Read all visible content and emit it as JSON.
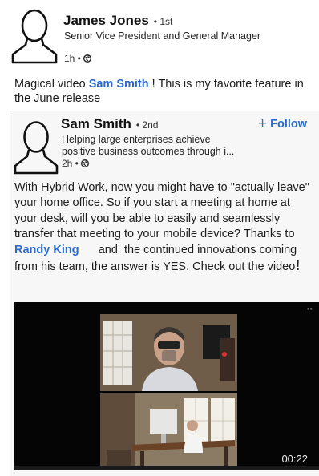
{
  "outer_post": {
    "author_name": "James Jones",
    "degree": "• 1st",
    "headline": "Senior Vice President and General Manager",
    "time": "1h •",
    "text_before": "Magical video ",
    "mention": "Sam Smith",
    "text_after": " ! This is my favorite feature in the June release"
  },
  "shared_post": {
    "author_name": "Sam Smith",
    "degree": "• 2nd",
    "headline_line1": "Helping large enterprises achieve",
    "headline_line2": "positive business outcomes through i...",
    "time": "2h •",
    "follow_label": "Follow",
    "text_part1": "With Hybrid Work, now you might have to \"actually leave\" your home office. So if you start a meeting at home at your desk, will you  be able to easily and seamlessly transfer that meeting to your mobile device? Thanks to ",
    "mention": "Randy King",
    "text_part2": "      and  the continued innovations coming from his team, the answer is YES. Check out the video",
    "text_end": "!"
  },
  "video": {
    "duration": "00:22"
  },
  "icons": {
    "avatar": "person-outline-icon",
    "globe": "globe-icon",
    "follow": "plus-icon"
  }
}
